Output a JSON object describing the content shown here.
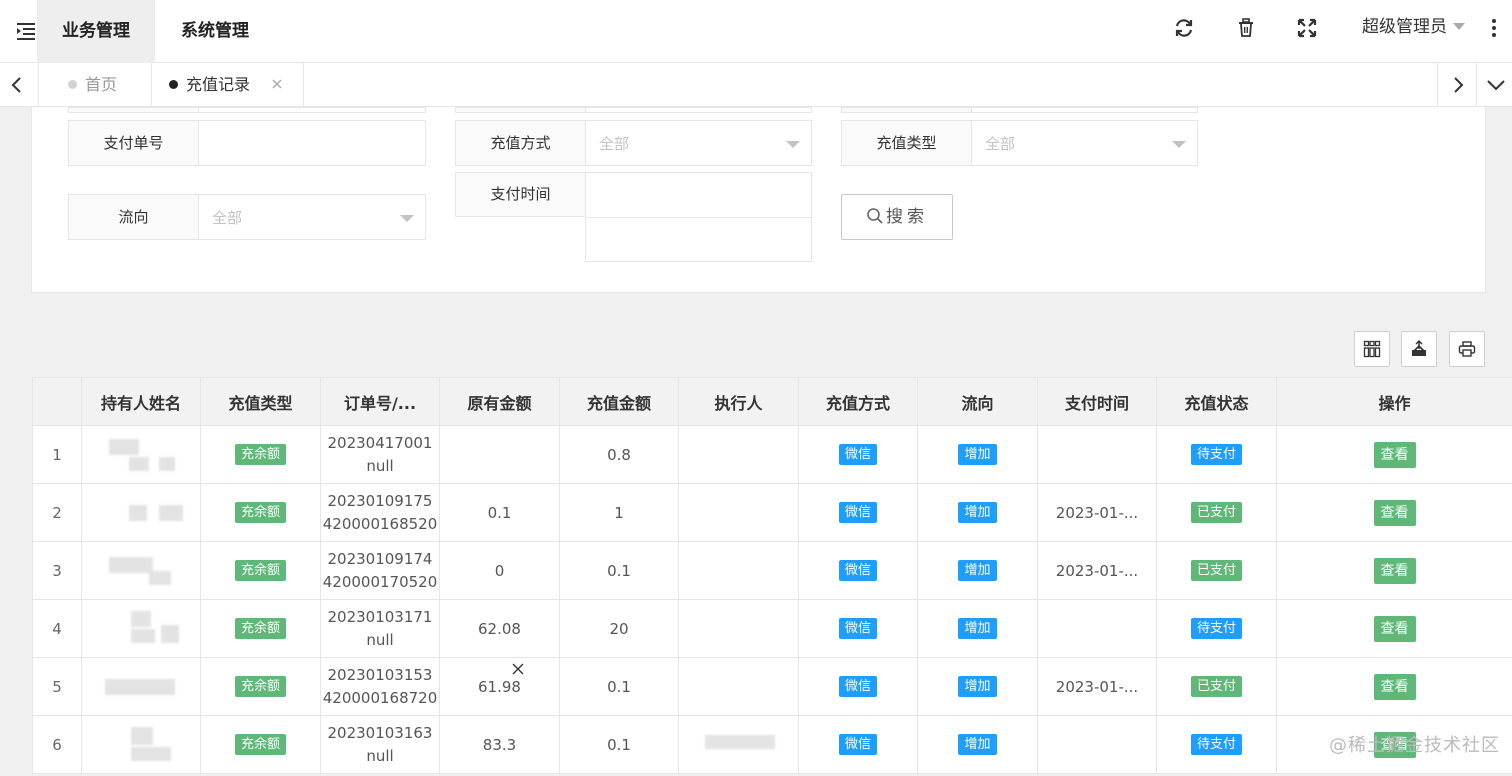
{
  "header": {
    "top_tabs": [
      {
        "label": "业务管理",
        "active": true
      },
      {
        "label": "系统管理",
        "active": false
      }
    ],
    "user_name": "超级管理员",
    "icons": [
      "menu-icon",
      "refresh-icon",
      "trash-icon",
      "fullscreen-icon",
      "more-icon"
    ]
  },
  "tabs": [
    {
      "label": "首页",
      "active": false
    },
    {
      "label": "充值记录",
      "active": true
    }
  ],
  "filters": {
    "pay_no": {
      "label": "支付单号",
      "value": ""
    },
    "method": {
      "label": "充值方式",
      "value": "全部"
    },
    "type": {
      "label": "充值类型",
      "value": "全部"
    },
    "flow": {
      "label": "流向",
      "value": "全部"
    },
    "pay_time": {
      "label": "支付时间",
      "value": ""
    },
    "search_label": "搜索"
  },
  "table": {
    "columns": [
      "",
      "持有人姓名",
      "充值类型",
      "订单号/...",
      "原有金额",
      "充值金额",
      "执行人",
      "充值方式",
      "流向",
      "支付时间",
      "充值状态",
      "操作"
    ],
    "rows": [
      {
        "idx": "1",
        "type": "充余额",
        "order1": "20230417001",
        "order2": "null",
        "orig": "",
        "amount": "0.8",
        "method": "微信",
        "flow": "增加",
        "paytime": "",
        "status": "待支付",
        "action": "查看"
      },
      {
        "idx": "2",
        "type": "充余额",
        "order1": "20230109175",
        "order2": "420000168520",
        "orig": "0.1",
        "amount": "1",
        "method": "微信",
        "flow": "增加",
        "paytime": "2023-01-...",
        "status": "已支付",
        "action": "查看"
      },
      {
        "idx": "3",
        "type": "充余额",
        "order1": "20230109174",
        "order2": "420000170520",
        "orig": "0",
        "amount": "0.1",
        "method": "微信",
        "flow": "增加",
        "paytime": "2023-01-...",
        "status": "已支付",
        "action": "查看"
      },
      {
        "idx": "4",
        "type": "充余额",
        "order1": "20230103171",
        "order2": "null",
        "orig": "62.08",
        "amount": "20",
        "method": "微信",
        "flow": "增加",
        "paytime": "",
        "status": "待支付",
        "action": "查看"
      },
      {
        "idx": "5",
        "type": "充余额",
        "order1": "20230103153",
        "order2": "420000168720",
        "orig": "61.98",
        "amount": "0.1",
        "method": "微信",
        "flow": "增加",
        "paytime": "2023-01-...",
        "status": "已支付",
        "action": "查看"
      },
      {
        "idx": "6",
        "type": "充余额",
        "order1": "20230103163",
        "order2": "null",
        "orig": "83.3",
        "amount": "0.1",
        "method": "微信",
        "flow": "增加",
        "paytime": "",
        "status": "待支付",
        "action": "查看"
      }
    ]
  },
  "watermark": "@稀土掘金技术社区",
  "colors": {
    "green": "#5fb878",
    "blue": "#1e9fff"
  }
}
